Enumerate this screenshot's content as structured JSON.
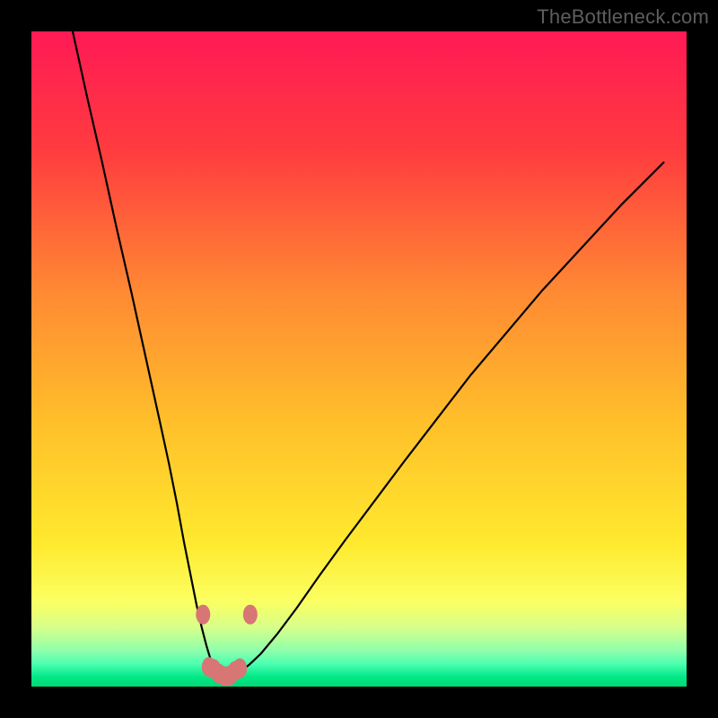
{
  "watermark": "TheBottleneck.com",
  "colors": {
    "black": "#000000",
    "curve": "#000000",
    "marker_fill": "#d77674",
    "marker_stroke": "#d77674",
    "gradient_stops": [
      {
        "offset": 0.0,
        "color": "#ff1a55"
      },
      {
        "offset": 0.18,
        "color": "#ff3b3f"
      },
      {
        "offset": 0.4,
        "color": "#ff8a33"
      },
      {
        "offset": 0.6,
        "color": "#ffc02a"
      },
      {
        "offset": 0.78,
        "color": "#ffe92e"
      },
      {
        "offset": 0.87,
        "color": "#fbff62"
      },
      {
        "offset": 0.91,
        "color": "#d6ff8a"
      },
      {
        "offset": 0.945,
        "color": "#8fffac"
      },
      {
        "offset": 0.965,
        "color": "#4dffb0"
      },
      {
        "offset": 0.985,
        "color": "#02e887"
      },
      {
        "offset": 1.0,
        "color": "#01d874"
      }
    ]
  },
  "chart_data": {
    "type": "line",
    "title": "",
    "xlabel": "",
    "ylabel": "",
    "xlim": [
      0,
      100
    ],
    "ylim": [
      0,
      100
    ],
    "grid": false,
    "legend": false,
    "x": [
      6.3,
      8.5,
      10.8,
      13.0,
      15.3,
      17.5,
      19.7,
      21.0,
      22.2,
      23.3,
      24.3,
      25.2,
      26.0,
      26.7,
      27.3,
      27.9,
      28.5,
      29.0,
      29.7,
      30.5,
      31.7,
      33.2,
      35.0,
      37.5,
      40.5,
      44.0,
      48.0,
      52.5,
      57.0,
      62.0,
      67.0,
      72.5,
      78.0,
      84.0,
      90.0,
      96.5
    ],
    "values": [
      100.0,
      90.0,
      80.0,
      70.0,
      60.0,
      50.0,
      40.0,
      34.0,
      28.0,
      22.0,
      17.0,
      12.5,
      9.0,
      6.3,
      4.3,
      2.9,
      2.0,
      1.6,
      1.5,
      1.6,
      2.2,
      3.3,
      5.0,
      8.0,
      12.0,
      17.0,
      22.5,
      28.5,
      34.5,
      41.0,
      47.5,
      54.0,
      60.5,
      67.0,
      73.5,
      80.0
    ],
    "valley_band_y": 11.5,
    "markers": [
      {
        "x": 26.2,
        "y": 11.0
      },
      {
        "x": 27.1,
        "y": 3.0
      },
      {
        "x": 27.8,
        "y": 2.7
      },
      {
        "x": 28.6,
        "y": 2.0
      },
      {
        "x": 29.5,
        "y": 1.6
      },
      {
        "x": 30.3,
        "y": 1.7
      },
      {
        "x": 31.1,
        "y": 2.4
      },
      {
        "x": 31.8,
        "y": 2.8
      },
      {
        "x": 33.4,
        "y": 11.0
      }
    ]
  }
}
